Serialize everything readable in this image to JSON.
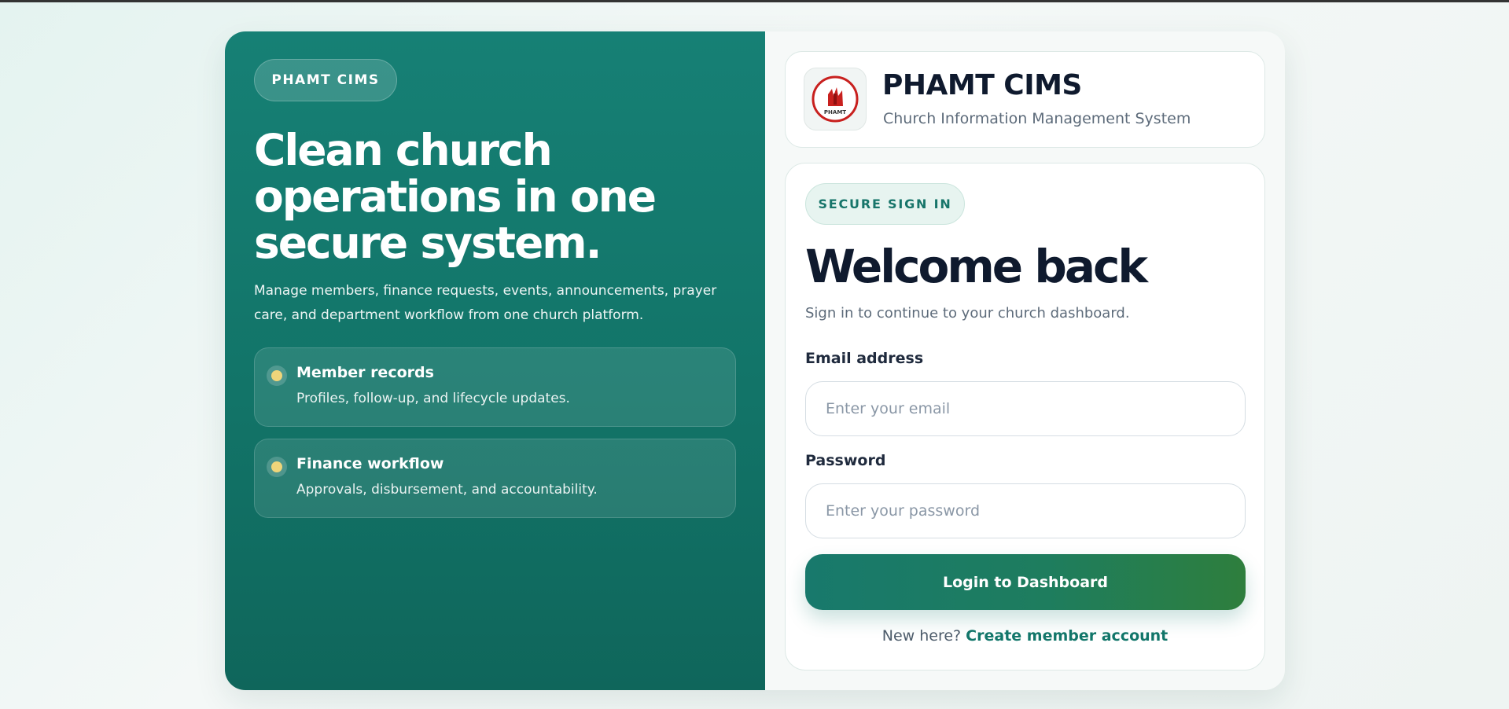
{
  "hero": {
    "badge": "PHAMT CIMS",
    "title": "Clean church operations in one secure system.",
    "description": "Manage members, finance requests, events, announcements, prayer care, and department workflow from one church platform.",
    "features": [
      {
        "title": "Member records",
        "description": "Profiles, follow-up, and lifecycle updates."
      },
      {
        "title": "Finance workflow",
        "description": "Approvals, disbursement, and accountability."
      }
    ]
  },
  "brand": {
    "logo_text": "PHAMT",
    "name": "PHAMT CIMS",
    "subtitle": "Church Information Management System"
  },
  "form": {
    "badge": "SECURE SIGN IN",
    "heading": "Welcome back",
    "subheading": "Sign in to continue to your church dashboard.",
    "email_label": "Email address",
    "email_placeholder": "Enter your email",
    "email_value": "",
    "password_label": "Password",
    "password_placeholder": "Enter your password",
    "password_value": "",
    "submit_label": "Login to Dashboard",
    "signup_prompt": "New here?",
    "signup_link": "Create member account"
  },
  "colors": {
    "primary": "#168075",
    "accent_dot": "#efd57a",
    "logo_red": "#c8201e",
    "heading": "#0f1a2e"
  },
  "icons": {
    "logo": "church-logo",
    "feature_bullet": "dot-icon"
  }
}
